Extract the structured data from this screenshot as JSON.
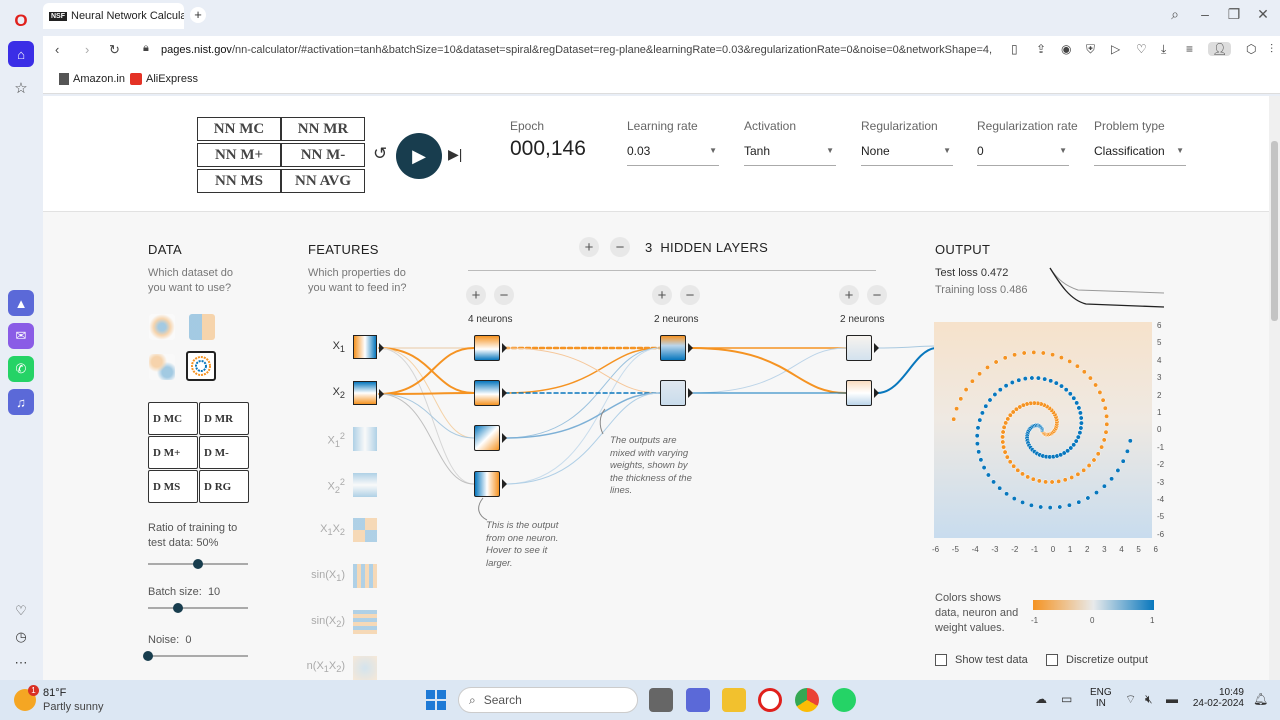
{
  "browser": {
    "tab_title": "Neural Network Calculator",
    "tab_favicon": "NSF",
    "url_host": "pages.nist.gov",
    "url_path": "/nn-calculator/#activation=tanh&batchSize=10&dataset=spiral&regDataset=reg-plane&learningRate=0.03&regularizationRate=0&noise=0&networkShape=4,",
    "bookmarks": [
      "Amazon.in",
      "AliExpress"
    ]
  },
  "calculator": {
    "nn_buttons": [
      "NN MC",
      "NN MR",
      "NN M+",
      "NN M-",
      "NN MS",
      "NN AVG"
    ],
    "d_buttons": [
      "D MC",
      "D MR",
      "D M+",
      "D M-",
      "D MS",
      "D RG"
    ]
  },
  "controls": {
    "epoch_label": "Epoch",
    "epoch_value": "000,146",
    "learning_rate_label": "Learning rate",
    "learning_rate_value": "0.03",
    "activation_label": "Activation",
    "activation_value": "Tanh",
    "regularization_label": "Regularization",
    "regularization_value": "None",
    "regularization_rate_label": "Regularization rate",
    "regularization_rate_value": "0",
    "problem_type_label": "Problem type",
    "problem_type_value": "Classification"
  },
  "data_panel": {
    "title": "DATA",
    "question": "Which dataset do you want to use?",
    "ratio_label": "Ratio of training to test data:",
    "ratio_value": "50%",
    "ratio_fraction": 0.5,
    "batch_label": "Batch size:",
    "batch_value": "10",
    "batch_fraction": 0.3,
    "noise_label": "Noise:",
    "noise_value": "0",
    "noise_fraction": 0
  },
  "features_panel": {
    "title": "FEATURES",
    "question": "Which properties do you want to feed in?",
    "features": [
      "X",
      "X",
      "X",
      "X",
      "X",
      "sin(X",
      "sin(X",
      "n(X"
    ]
  },
  "network": {
    "hidden_layers_count": "3",
    "hidden_layers_label": "HIDDEN LAYERS",
    "layers": [
      {
        "neurons_label": "4 neurons"
      },
      {
        "neurons_label": "2 neurons"
      },
      {
        "neurons_label": "2 neurons"
      }
    ],
    "note_neuron": "This is the output from one neuron. Hover to see it larger.",
    "note_weights": "The outputs are mixed with varying weights, shown by the thickness of the lines."
  },
  "output_panel": {
    "title": "OUTPUT",
    "test_loss_label": "Test loss",
    "test_loss_value": "0.472",
    "training_loss_label": "Training loss",
    "training_loss_value": "0.486",
    "y_ticks": [
      "6",
      "5",
      "4",
      "3",
      "2",
      "1",
      "0",
      "-1",
      "-2",
      "-3",
      "-4",
      "-5",
      "-6"
    ],
    "x_ticks": [
      "-6",
      "-5",
      "-4",
      "-3",
      "-2",
      "-1",
      "0",
      "1",
      "2",
      "3",
      "4",
      "5",
      "6"
    ],
    "legend_text": "Colors shows data, neuron and weight values.",
    "legend_min": "-1",
    "legend_mid": "0",
    "legend_max": "1",
    "show_test_data": "Show test data",
    "discretize_output": "Discretize output",
    "orange_color": "#f59322",
    "blue_color": "#0877bd"
  },
  "taskbar": {
    "weather_temp": "81°F",
    "weather_desc": "Partly sunny",
    "search_placeholder": "Search",
    "lang_top": "ENG",
    "lang_bottom": "IN",
    "time": "10:49",
    "date": "24-02-2024"
  }
}
